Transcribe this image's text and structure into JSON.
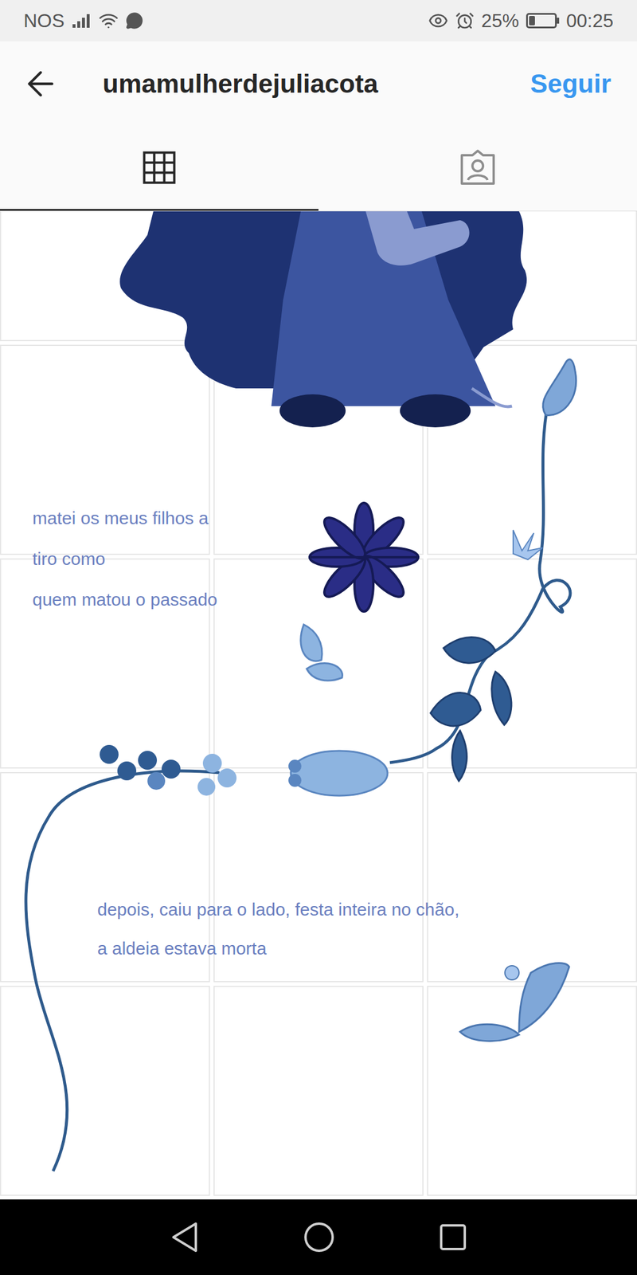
{
  "status_bar": {
    "carrier": "NOS",
    "battery": "25%",
    "battery_level": 0.25,
    "time": "00:25"
  },
  "header": {
    "username": "umamulherdejuliacota",
    "follow_button": "Seguir"
  },
  "tabs": [
    {
      "kind": "grid",
      "selected": true
    },
    {
      "kind": "tagged",
      "selected": false
    }
  ],
  "artwork": {
    "texts": [
      {
        "lines": [
          "matei os meus filhos a",
          "tiro como",
          "quem matou o passado"
        ]
      },
      {
        "lines": [
          "depois, caiu para o lado, festa inteira no chão,",
          "a aldeia estava morta"
        ]
      }
    ]
  }
}
